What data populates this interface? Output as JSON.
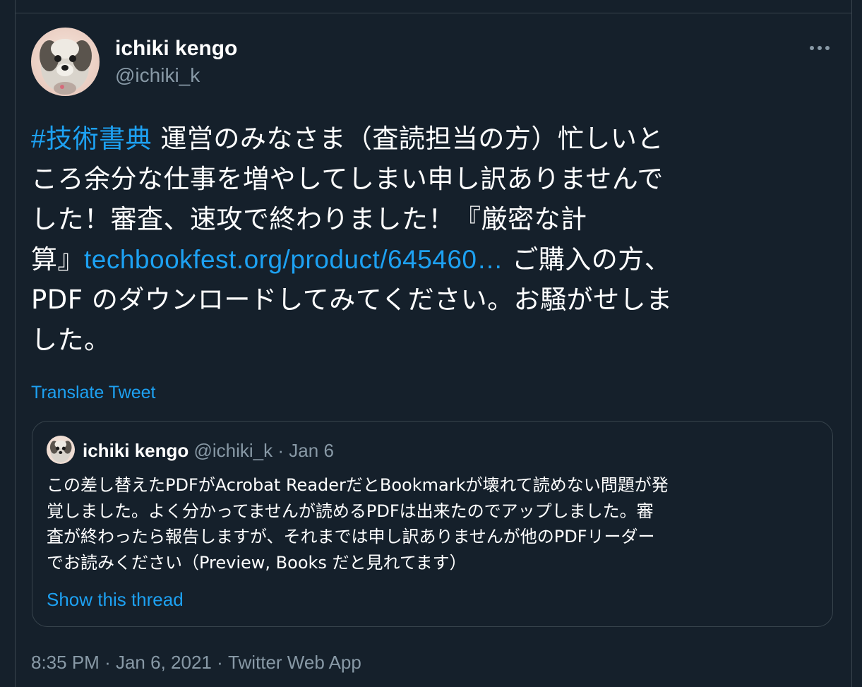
{
  "author": {
    "name": "ichiki kengo",
    "handle": "@ichiki_k"
  },
  "more_icon": "more-horizontal-icon",
  "tweet": {
    "hashtag": "#技術書典",
    "lines": [
      " 運営のみなさま（査読担当の方）忙しいと",
      "ころ余分な仕事を増やしてしまい申し訳ありませんで",
      "した！審査、速攻で終わりました！『厳密な計",
      "算』"
    ],
    "link_text": "techbookfest.org/product/645460…",
    "after_link": " ご購入の方、",
    "lines_after": [
      "PDF のダウンロードしてみてください。お騒がせしま",
      "した。"
    ]
  },
  "translate_label": "Translate Tweet",
  "quoted": {
    "name": "ichiki kengo",
    "handle": "@ichiki_k",
    "separator": "·",
    "date": "Jan 6",
    "lines": [
      "この差し替えたPDFがAcrobat ReaderだとBookmarkが壊れて読めない問題が発",
      "覚しました。よく分かってませんが読めるPDFは出来たのでアップしました。審",
      "査が終わったら報告しますが、それまでは申し訳ありませんが他のPDFリーダー",
      "でお読みください（Preview, Books だと見れてます）"
    ],
    "show_thread": "Show this thread"
  },
  "meta": {
    "time": "8:35 PM",
    "sep1": "·",
    "date": "Jan 6, 2021",
    "sep2": "·",
    "source": "Twitter Web App"
  },
  "colors": {
    "background": "#15202b",
    "accent": "#1da1f2",
    "secondary_text": "#8899a6",
    "border": "#38444d"
  }
}
